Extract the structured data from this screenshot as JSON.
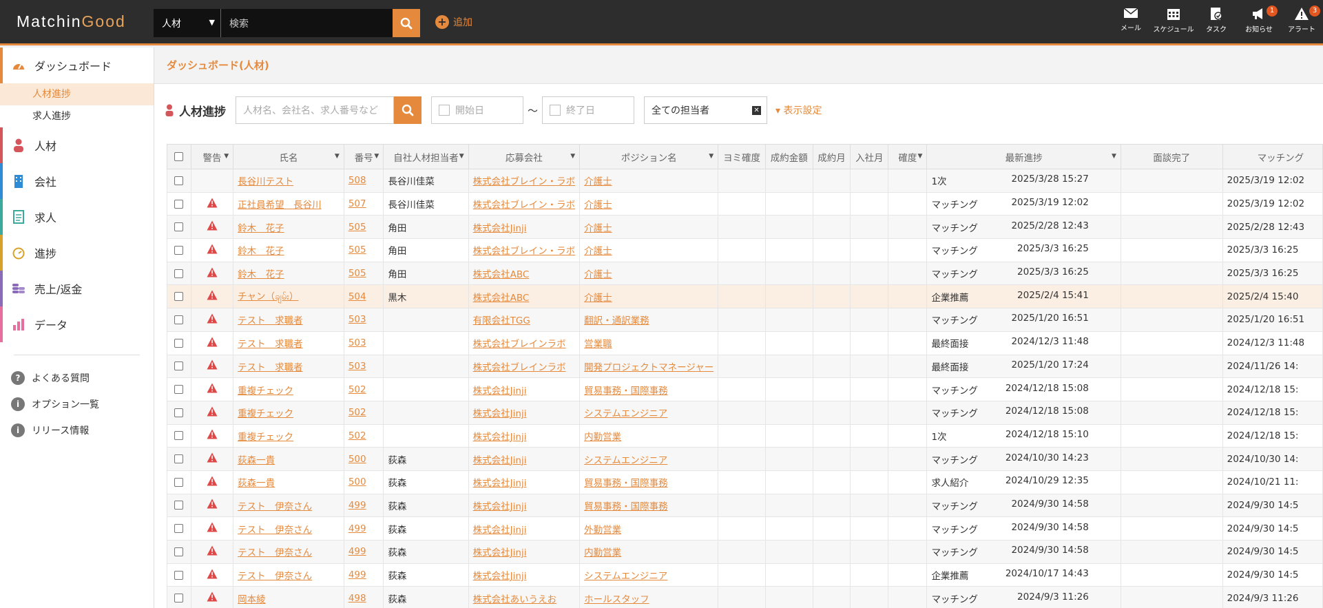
{
  "app": {
    "logo_a": "Matchin",
    "logo_b": "Good"
  },
  "search": {
    "type": "人材",
    "placeholder": "検索"
  },
  "add_label": "追加",
  "top_icons": [
    {
      "label": "メール",
      "icon": "mail-icon",
      "badge": ""
    },
    {
      "label": "スケジュール",
      "icon": "calendar-icon",
      "badge": ""
    },
    {
      "label": "タスク",
      "icon": "task-icon",
      "badge": ""
    },
    {
      "label": "お知らせ",
      "icon": "megaphone-icon",
      "badge": "1"
    },
    {
      "label": "アラート",
      "icon": "alert-icon",
      "badge": "3"
    }
  ],
  "sidebar": {
    "dashboard": "ダッシュボード",
    "sub": [
      "人材進捗",
      "求人進捗"
    ],
    "items": [
      "人材",
      "会社",
      "求人",
      "進捗",
      "売上/返金",
      "データ"
    ],
    "help": [
      "よくある質問",
      "オプション一覧",
      "リリース情報"
    ]
  },
  "breadcrumb": "ダッシュボード(人材)",
  "toolbar": {
    "title": "人材進捗",
    "kw_placeholder": "人材名、会社名、求人番号など",
    "start": "開始日",
    "end": "終了日",
    "tilde": "～",
    "assignee": "全ての担当者",
    "display": "表示設定"
  },
  "columns": [
    "警告",
    "氏名",
    "番号",
    "自社人材担当者",
    "応募会社",
    "ポジション名",
    "ヨミ確度",
    "成約金額",
    "成約月",
    "入社月",
    "確度",
    "最新進捗",
    "面談完了",
    "マッチング"
  ],
  "rows": [
    {
      "warn": false,
      "name": "長谷川テスト",
      "no": "508",
      "owner": "長谷川佳菜",
      "company": "株式会社ブレイン・ラボ",
      "position": "介護士",
      "status": "1次",
      "date": "2025/3/28 15:27",
      "match": "2025/3/19 12:02"
    },
    {
      "warn": true,
      "name": "正社員希望　長谷川",
      "no": "507",
      "owner": "長谷川佳菜",
      "company": "株式会社ブレイン・ラボ",
      "position": "介護士",
      "status": "マッチング",
      "date": "2025/3/19 12:02",
      "match": "2025/3/19 12:02"
    },
    {
      "warn": true,
      "name": "鈴木　花子",
      "no": "505",
      "owner": "角田",
      "company": "株式会社Jinji",
      "position": "介護士",
      "status": "マッチング",
      "date": "2025/2/28 12:43",
      "match": "2025/2/28 12:43"
    },
    {
      "warn": true,
      "name": "鈴木　花子",
      "no": "505",
      "owner": "角田",
      "company": "株式会社ブレイン・ラボ",
      "position": "介護士",
      "status": "マッチング",
      "date": "2025/3/3 16:25",
      "match": "2025/3/3 16:25"
    },
    {
      "warn": true,
      "name": "鈴木　花子",
      "no": "505",
      "owner": "角田",
      "company": "株式会社ABC",
      "position": "介護士",
      "status": "マッチング",
      "date": "2025/3/3 16:25",
      "match": "2025/3/3 16:25"
    },
    {
      "warn": true,
      "name": "チャン（ချမ်း）",
      "no": "504",
      "owner": "黒木",
      "company": "株式会社ABC",
      "position": "介護士",
      "status": "企業推薦",
      "date": "2025/2/4 15:41",
      "match": "2025/2/4 15:40"
    },
    {
      "warn": true,
      "name": "テスト　求職者",
      "no": "503",
      "owner": "",
      "company": "有限会社TGG",
      "position": "翻訳・通訳業務",
      "status": "マッチング",
      "date": "2025/1/20 16:51",
      "match": "2025/1/20 16:51"
    },
    {
      "warn": true,
      "name": "テスト　求職者",
      "no": "503",
      "owner": "",
      "company": "株式会社ブレインラボ",
      "position": "営業職",
      "status": "最終面接",
      "date": "2024/12/3 11:48",
      "match": "2024/12/3 11:48"
    },
    {
      "warn": true,
      "name": "テスト　求職者",
      "no": "503",
      "owner": "",
      "company": "株式会社ブレインラボ",
      "position": "開発プロジェクトマネージャー",
      "status": "最終面接",
      "date": "2025/1/20 17:24",
      "match": "2024/11/26 14:"
    },
    {
      "warn": true,
      "name": "重複チェック",
      "no": "502",
      "owner": "",
      "company": "株式会社Jinji",
      "position": "貿易事務・国際事務",
      "status": "マッチング",
      "date": "2024/12/18 15:08",
      "match": "2024/12/18 15:"
    },
    {
      "warn": true,
      "name": "重複チェック",
      "no": "502",
      "owner": "",
      "company": "株式会社Jinji",
      "position": "システムエンジニア",
      "status": "マッチング",
      "date": "2024/12/18 15:08",
      "match": "2024/12/18 15:"
    },
    {
      "warn": true,
      "name": "重複チェック",
      "no": "502",
      "owner": "",
      "company": "株式会社Jinji",
      "position": "内勤営業",
      "status": "1次",
      "date": "2024/12/18 15:10",
      "match": "2024/12/18 15:"
    },
    {
      "warn": true,
      "name": "荻森一貴",
      "no": "500",
      "owner": "荻森",
      "company": "株式会社Jinji",
      "position": "システムエンジニア",
      "status": "マッチング",
      "date": "2024/10/30 14:23",
      "match": "2024/10/30 14:"
    },
    {
      "warn": true,
      "name": "荻森一貴",
      "no": "500",
      "owner": "荻森",
      "company": "株式会社Jinji",
      "position": "貿易事務・国際事務",
      "status": "求人紹介",
      "date": "2024/10/29 12:35",
      "match": "2024/10/21 11:"
    },
    {
      "warn": true,
      "name": "テスト　伊奈さん",
      "no": "499",
      "owner": "荻森",
      "company": "株式会社Jinji",
      "position": "貿易事務・国際事務",
      "status": "マッチング",
      "date": "2024/9/30 14:58",
      "match": "2024/9/30 14:5"
    },
    {
      "warn": true,
      "name": "テスト　伊奈さん",
      "no": "499",
      "owner": "荻森",
      "company": "株式会社Jinji",
      "position": "外勤営業",
      "status": "マッチング",
      "date": "2024/9/30 14:58",
      "match": "2024/9/30 14:5"
    },
    {
      "warn": true,
      "name": "テスト　伊奈さん",
      "no": "499",
      "owner": "荻森",
      "company": "株式会社Jinji",
      "position": "内勤営業",
      "status": "マッチング",
      "date": "2024/9/30 14:58",
      "match": "2024/9/30 14:5"
    },
    {
      "warn": true,
      "name": "テスト　伊奈さん",
      "no": "499",
      "owner": "荻森",
      "company": "株式会社Jinji",
      "position": "システムエンジニア",
      "status": "企業推薦",
      "date": "2024/10/17 14:43",
      "match": "2024/9/30 14:5"
    },
    {
      "warn": true,
      "name": "岡本綾",
      "no": "498",
      "owner": "荻森",
      "company": "株式会社あいうえお",
      "position": "ホールスタッフ",
      "status": "マッチング",
      "date": "2024/9/3 11:26",
      "match": "2024/9/3 11:26"
    }
  ],
  "highlight_row": 5,
  "colors": {
    "accent": "#e58a3d",
    "topbar": "#2d2d2d",
    "warn": "#e04848"
  }
}
